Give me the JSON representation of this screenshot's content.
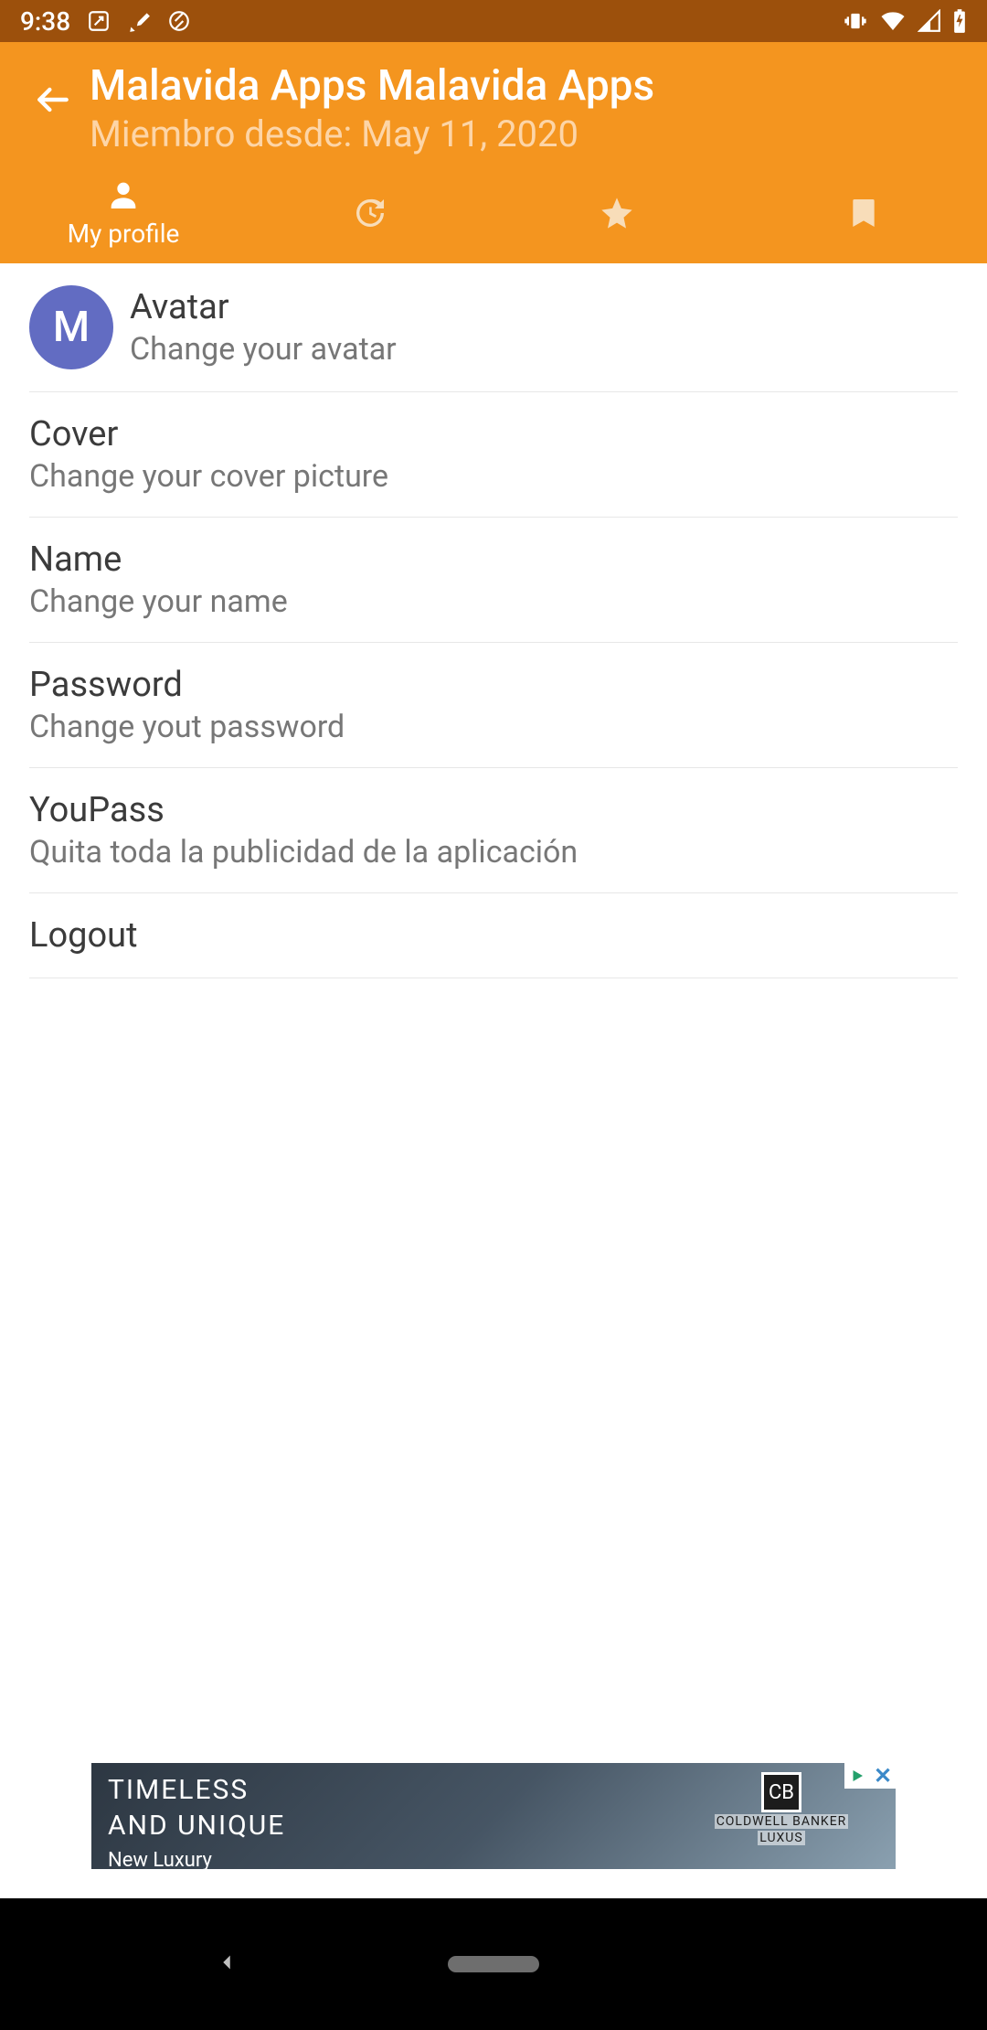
{
  "status": {
    "time": "9:38",
    "icons_left": [
      "screenshot-icon",
      "brush-icon",
      "at-icon"
    ],
    "icons_right": [
      "vibrate-icon",
      "wifi-icon",
      "signal-icon",
      "battery-icon"
    ]
  },
  "header": {
    "title": "Malavida Apps Malavida Apps",
    "subtitle": "Miembro desde: May 11, 2020",
    "back_aria": "Back"
  },
  "tabs": {
    "profile_label": "My profile"
  },
  "avatar": {
    "letter": "M"
  },
  "list": {
    "avatar": {
      "title": "Avatar",
      "sub": "Change your avatar"
    },
    "cover": {
      "title": "Cover",
      "sub": "Change your cover picture"
    },
    "name": {
      "title": "Name",
      "sub": "Change your name"
    },
    "password": {
      "title": "Password",
      "sub": "Change yout password"
    },
    "youpass": {
      "title": "YouPass",
      "sub": "Quita toda la publicidad de la aplicación"
    },
    "logout": {
      "title": "Logout"
    }
  },
  "ad": {
    "line1": "TIMELESS",
    "line2": "AND UNIQUE",
    "small": "New Luxury",
    "brand": "COLDWELL BANKER",
    "brand2": "LUXUS",
    "logo_letters": "CB"
  }
}
